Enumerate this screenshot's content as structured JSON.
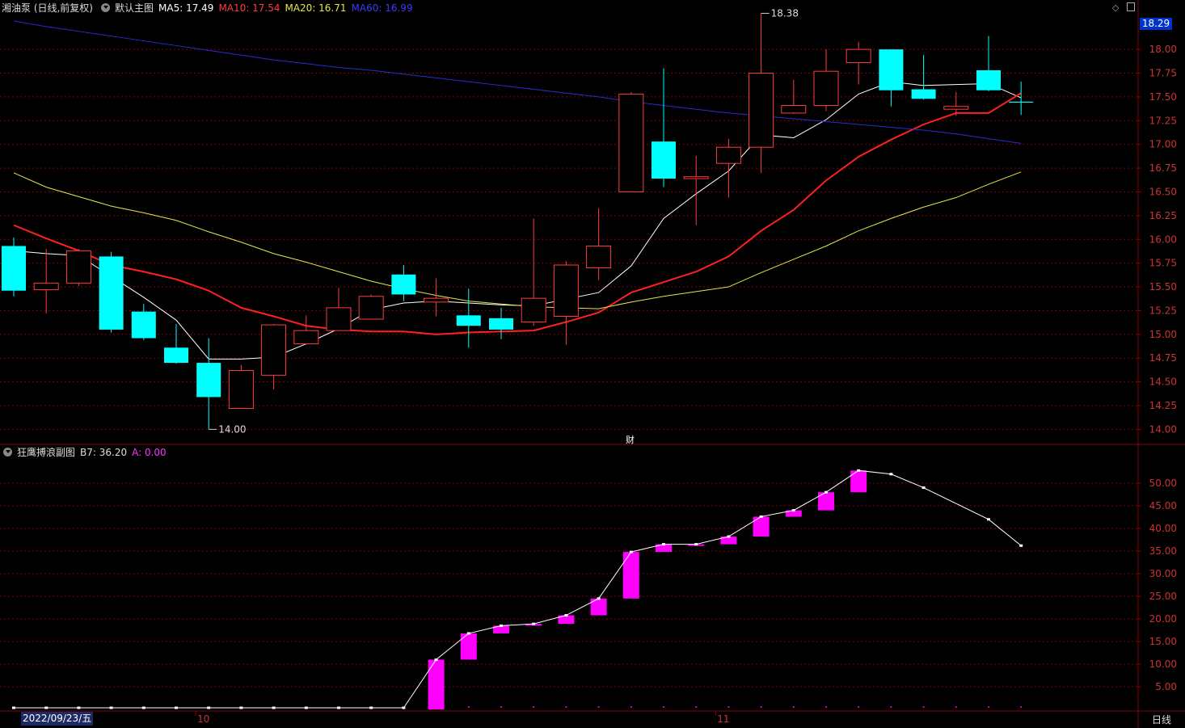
{
  "header": {
    "stock": "湘油泵 (日线,前复权)",
    "main_label": "默认主图",
    "ma5": "MA5: 17.49",
    "ma10": "MA10: 17.54",
    "ma20": "MA20: 16.71",
    "ma60": "MA60: 16.99"
  },
  "sub_header": {
    "name": "狂鹰搏浪副图",
    "b7": "B7: 36.20",
    "a": "A: 0.00"
  },
  "colors": {
    "up": "#ff3b3b",
    "down": "#00ffff",
    "ma5": "#ffffff",
    "ma10": "#ff2020",
    "ma20": "#e6e64c",
    "ma60": "#2b2bd6",
    "bar": "#ff00ff",
    "grid": "#8b0000",
    "axis_text": "#cc3333"
  },
  "price_tag": "18.29",
  "cai_label": "财",
  "period_label": "日线",
  "date_badge": "2022/09/23/五",
  "chart_data": [
    {
      "type": "candlestick",
      "ylim": [
        13.85,
        18.35
      ],
      "yticks": [
        "18.00",
        "17.75",
        "17.50",
        "17.25",
        "17.00",
        "16.75",
        "16.50",
        "16.25",
        "16.00",
        "15.75",
        "15.50",
        "15.25",
        "15.00",
        "14.75",
        "14.50",
        "14.25",
        "14.00"
      ],
      "ytick_values": [
        18.0,
        17.75,
        17.5,
        17.25,
        17.0,
        16.75,
        16.5,
        16.25,
        16.0,
        15.75,
        15.5,
        15.25,
        15.0,
        14.75,
        14.5,
        14.25,
        14.0
      ],
      "x_labels": [
        {
          "index": 6,
          "label": "10"
        },
        {
          "index": 22,
          "label": "11"
        }
      ],
      "annotations": [
        {
          "index": 23,
          "value": 18.38,
          "text": "18.38"
        },
        {
          "index": 6,
          "value": 14.0,
          "text": "14.00"
        }
      ],
      "candles": [
        {
          "o": 15.93,
          "c": 15.46,
          "h": 16.02,
          "l": 15.4
        },
        {
          "o": 15.47,
          "c": 15.54,
          "h": 15.9,
          "l": 15.22
        },
        {
          "o": 15.54,
          "c": 15.88,
          "h": 15.9,
          "l": 15.51
        },
        {
          "o": 15.82,
          "c": 15.05,
          "h": 15.87,
          "l": 15.02
        },
        {
          "o": 15.24,
          "c": 14.96,
          "h": 15.32,
          "l": 14.94
        },
        {
          "o": 14.86,
          "c": 14.7,
          "h": 15.11,
          "l": 14.69
        },
        {
          "o": 14.7,
          "c": 14.34,
          "h": 14.96,
          "l": 14.0
        },
        {
          "o": 14.22,
          "c": 14.62,
          "h": 14.68,
          "l": 14.22
        },
        {
          "o": 14.57,
          "c": 15.1,
          "h": 15.11,
          "l": 14.42
        },
        {
          "o": 14.9,
          "c": 15.04,
          "h": 15.2,
          "l": 14.89
        },
        {
          "o": 15.04,
          "c": 15.28,
          "h": 15.49,
          "l": 15.04
        },
        {
          "o": 15.16,
          "c": 15.4,
          "h": 15.42,
          "l": 15.16
        },
        {
          "o": 15.63,
          "c": 15.42,
          "h": 15.73,
          "l": 15.35
        },
        {
          "o": 15.34,
          "c": 15.38,
          "h": 15.59,
          "l": 15.19
        },
        {
          "o": 15.2,
          "c": 15.09,
          "h": 15.48,
          "l": 14.86
        },
        {
          "o": 15.17,
          "c": 15.05,
          "h": 15.28,
          "l": 14.95
        },
        {
          "o": 15.13,
          "c": 15.38,
          "h": 16.22,
          "l": 15.09
        },
        {
          "o": 15.19,
          "c": 15.73,
          "h": 15.77,
          "l": 14.89
        },
        {
          "o": 15.7,
          "c": 15.93,
          "h": 16.33,
          "l": 15.57
        },
        {
          "o": 16.5,
          "c": 17.53,
          "h": 17.55,
          "l": 16.5
        },
        {
          "o": 17.03,
          "c": 16.64,
          "h": 17.8,
          "l": 16.55
        },
        {
          "o": 16.64,
          "c": 16.66,
          "h": 16.88,
          "l": 16.15
        },
        {
          "o": 16.8,
          "c": 16.97,
          "h": 17.06,
          "l": 16.44
        },
        {
          "o": 16.97,
          "c": 17.75,
          "h": 18.38,
          "l": 16.7
        },
        {
          "o": 17.33,
          "c": 17.41,
          "h": 17.68,
          "l": 17.32
        },
        {
          "o": 17.41,
          "c": 17.77,
          "h": 18.0,
          "l": 17.35
        },
        {
          "o": 17.86,
          "c": 18.0,
          "h": 18.08,
          "l": 17.63
        },
        {
          "o": 18.0,
          "c": 17.57,
          "h": 18.0,
          "l": 17.4
        },
        {
          "o": 17.58,
          "c": 17.48,
          "h": 17.94,
          "l": 17.47
        },
        {
          "o": 17.37,
          "c": 17.4,
          "h": 17.55,
          "l": 17.3
        },
        {
          "o": 17.78,
          "c": 17.57,
          "h": 18.14,
          "l": 17.56
        },
        {
          "o": 17.45,
          "c": 17.44,
          "h": 17.66,
          "l": 17.31
        }
      ],
      "series": [
        {
          "name": "MA5",
          "values": [
            15.88,
            15.85,
            15.83,
            15.61,
            15.39,
            15.15,
            14.74,
            14.74,
            14.76,
            14.9,
            15.06,
            15.26,
            15.33,
            15.35,
            15.33,
            15.31,
            15.3,
            15.37,
            15.44,
            15.72,
            16.22,
            16.48,
            16.72,
            17.1,
            17.07,
            17.26,
            17.53,
            17.66,
            17.62,
            17.63,
            17.64,
            17.49
          ]
        },
        {
          "name": "MA10",
          "values": [
            16.15,
            16.01,
            15.88,
            15.73,
            15.66,
            15.58,
            15.46,
            15.28,
            15.19,
            15.09,
            15.05,
            15.03,
            15.03,
            15.0,
            15.02,
            15.03,
            15.04,
            15.13,
            15.23,
            15.44,
            15.55,
            15.66,
            15.82,
            16.09,
            16.31,
            16.62,
            16.87,
            17.05,
            17.21,
            17.33,
            17.33,
            17.54
          ]
        },
        {
          "name": "MA20",
          "values": [
            16.7,
            16.55,
            16.45,
            16.35,
            16.28,
            16.2,
            16.08,
            15.97,
            15.85,
            15.76,
            15.66,
            15.56,
            15.48,
            15.41,
            15.35,
            15.32,
            15.29,
            15.28,
            15.27,
            15.34,
            15.4,
            15.45,
            15.5,
            15.65,
            15.79,
            15.93,
            16.09,
            16.22,
            16.34,
            16.44,
            16.58,
            16.71
          ]
        },
        {
          "name": "MA60",
          "values": [
            18.3,
            18.24,
            18.19,
            18.14,
            18.09,
            18.04,
            17.99,
            17.94,
            17.89,
            17.85,
            17.81,
            17.78,
            17.74,
            17.7,
            17.66,
            17.62,
            17.58,
            17.54,
            17.5,
            17.45,
            17.41,
            17.37,
            17.33,
            17.3,
            17.27,
            17.24,
            17.21,
            17.18,
            17.15,
            17.11,
            17.06,
            17.01
          ]
        }
      ]
    },
    {
      "type": "bar",
      "ylim": [
        0,
        55
      ],
      "yticks": [
        "50.00",
        "45.00",
        "40.00",
        "35.00",
        "30.00",
        "25.00",
        "20.00",
        "15.00",
        "10.00",
        "5.00"
      ],
      "ytick_values": [
        50,
        45,
        40,
        35,
        30,
        25,
        20,
        15,
        10,
        5
      ],
      "series": [
        {
          "name": "B7",
          "values": [
            0,
            0,
            0,
            0,
            0,
            0,
            0,
            0,
            0,
            0,
            0,
            0,
            0,
            11.0,
            16.8,
            18.5,
            18.9,
            20.8,
            24.5,
            34.8,
            36.5,
            36.5,
            38.2,
            42.6,
            44.0,
            48.0,
            52.8,
            52.0,
            49.0,
            null,
            42.0,
            36.2
          ]
        }
      ],
      "bars": [
        {
          "index": 13,
          "from": 0,
          "to": 11.0
        },
        {
          "index": 14,
          "from": 11.0,
          "to": 16.8
        },
        {
          "index": 15,
          "from": 16.8,
          "to": 18.5
        },
        {
          "index": 16,
          "from": 18.5,
          "to": 18.9
        },
        {
          "index": 17,
          "from": 18.9,
          "to": 20.8
        },
        {
          "index": 18,
          "from": 20.8,
          "to": 24.5
        },
        {
          "index": 19,
          "from": 24.5,
          "to": 34.8
        },
        {
          "index": 20,
          "from": 34.8,
          "to": 36.5
        },
        {
          "index": 21,
          "from": 36.5,
          "to": 36.5
        },
        {
          "index": 22,
          "from": 36.5,
          "to": 38.2
        },
        {
          "index": 23,
          "from": 38.2,
          "to": 42.6
        },
        {
          "index": 24,
          "from": 42.6,
          "to": 44.0
        },
        {
          "index": 25,
          "from": 44.0,
          "to": 48.0
        },
        {
          "index": 26,
          "from": 48.0,
          "to": 52.8
        }
      ]
    }
  ]
}
